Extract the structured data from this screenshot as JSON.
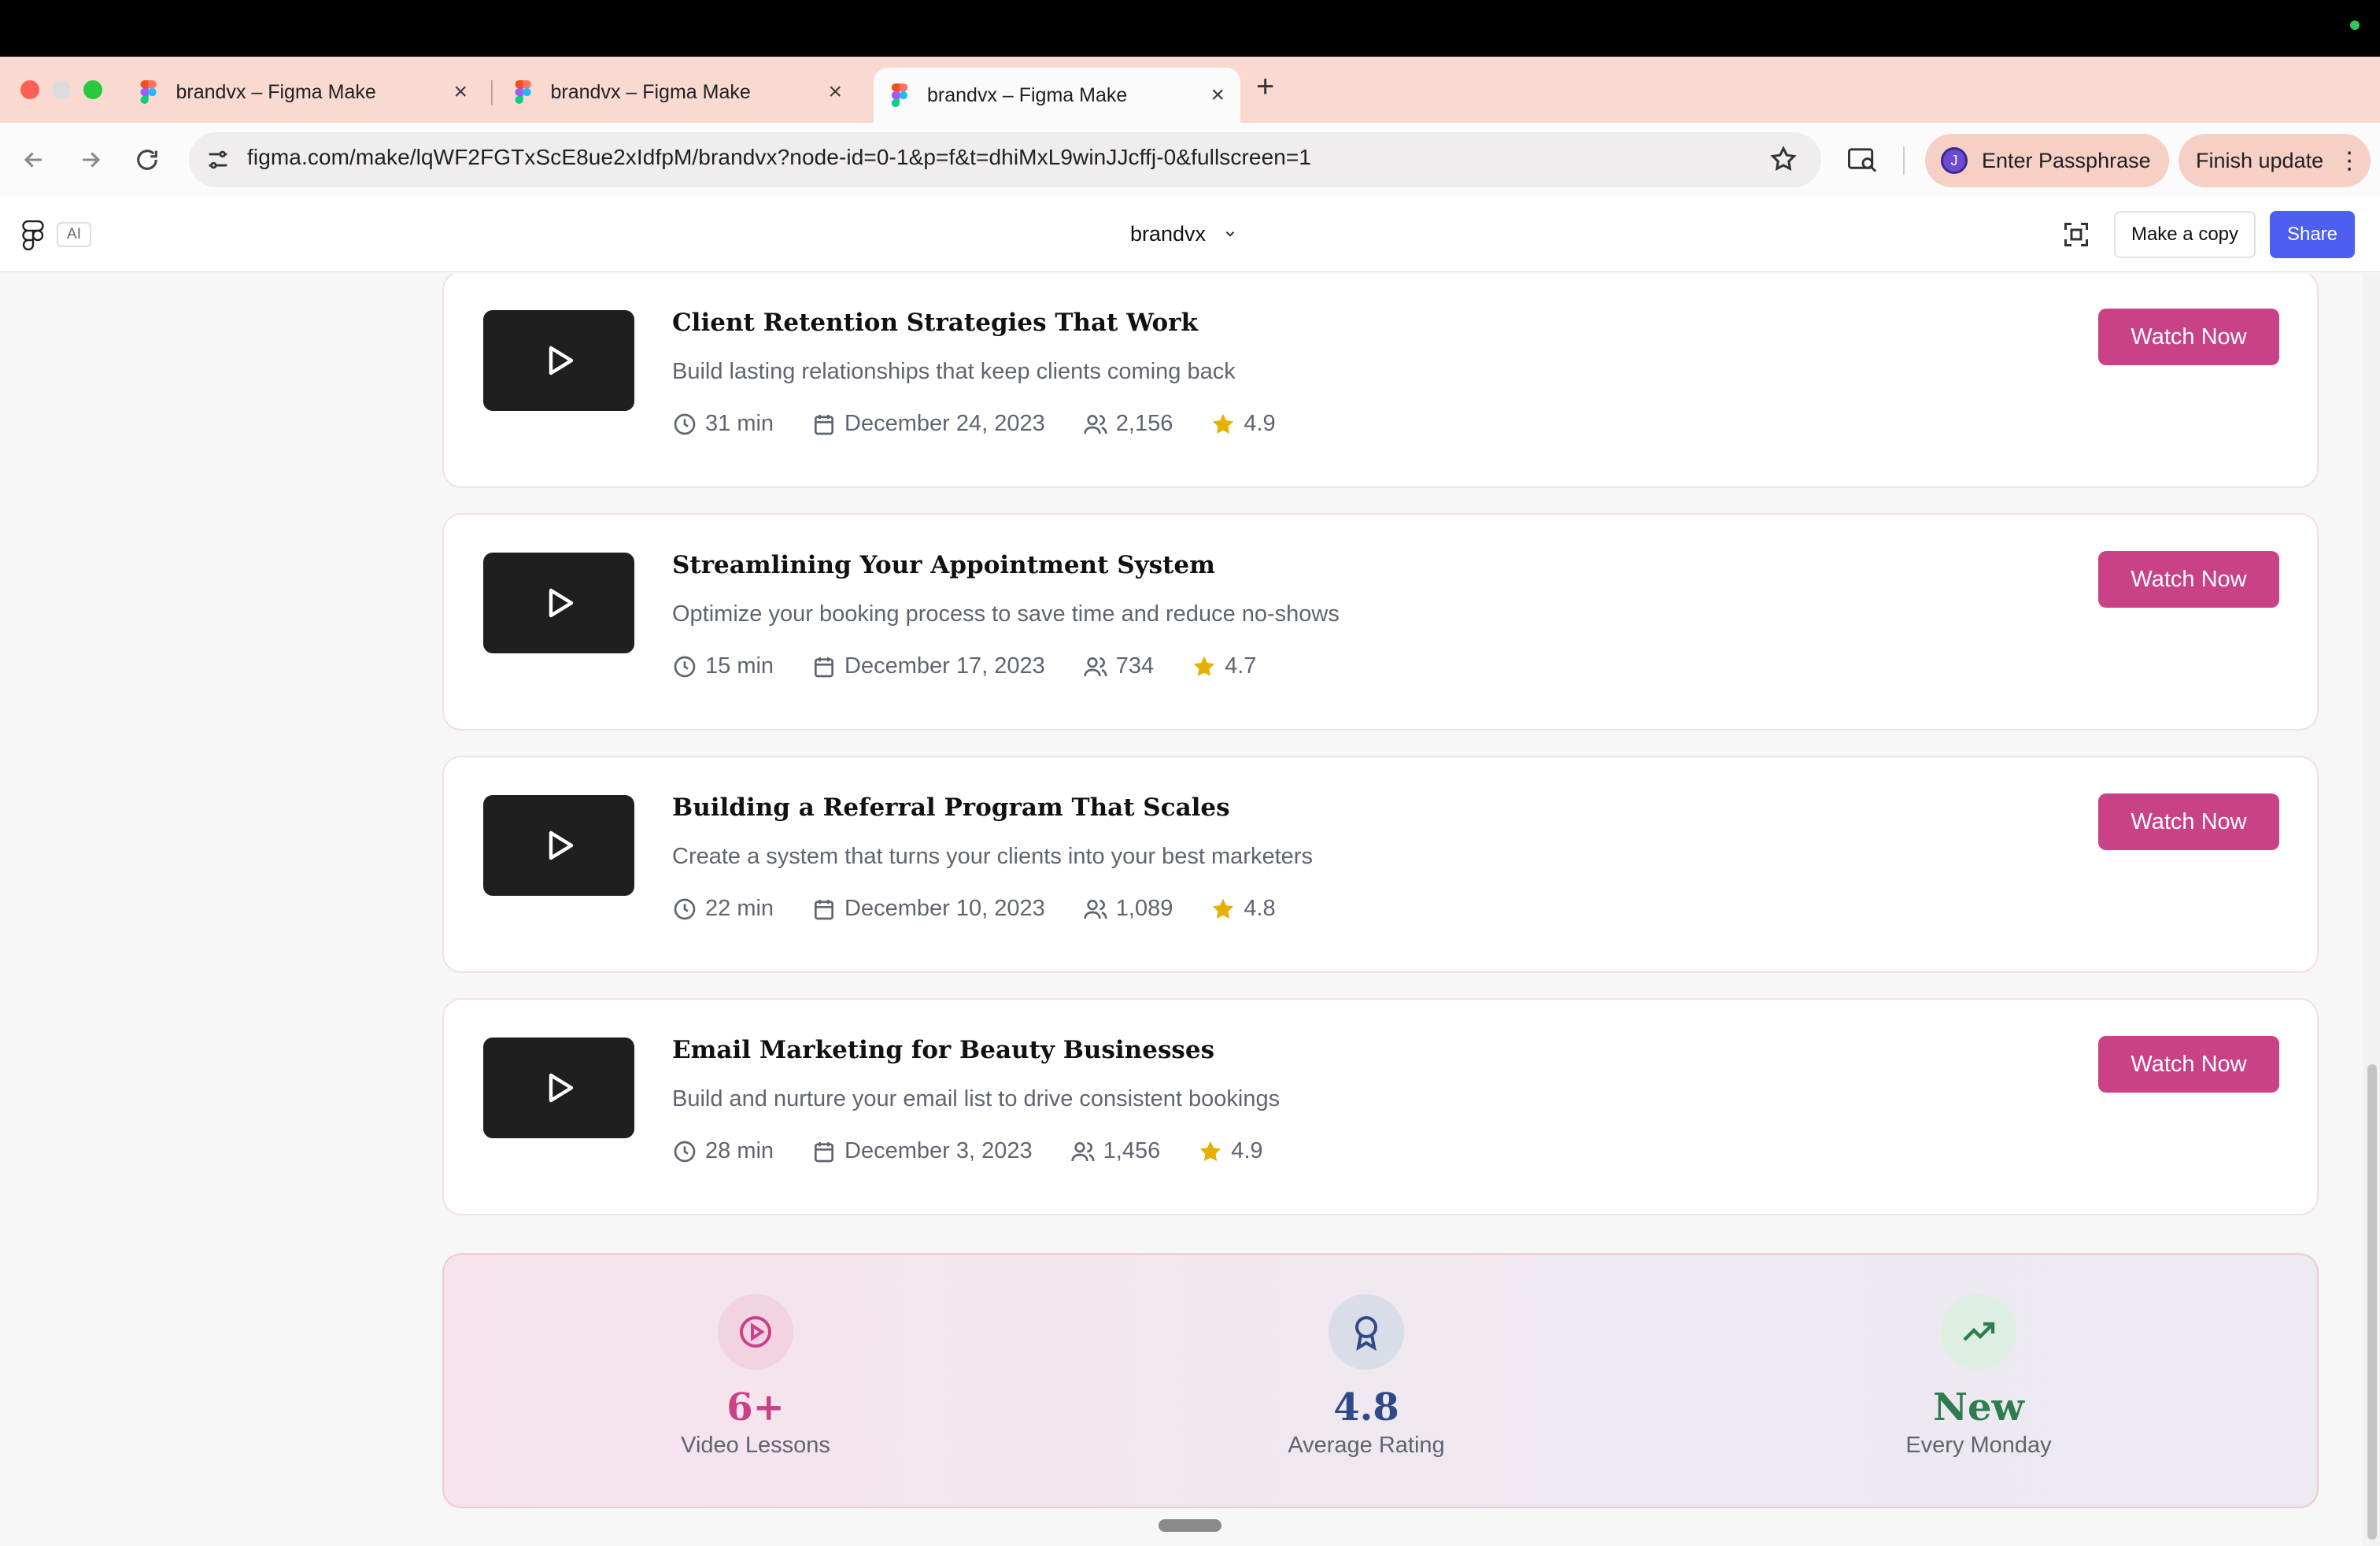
{
  "browser": {
    "tabs": [
      {
        "title": "brandvx – Figma Make"
      },
      {
        "title": "brandvx – Figma Make"
      },
      {
        "title": "brandvx – Figma Make"
      }
    ],
    "url": "figma.com/make/lqWF2FGTxScE8ue2xIdfpM/brandvx?node-id=0-1&p=f&t=dhiMxL9winJJcffj-0&fullscreen=1",
    "profile_initial": "J",
    "passphrase_label": "Enter Passphrase",
    "finish_update_label": "Finish update"
  },
  "header": {
    "ai_badge": "AI",
    "project_name": "brandvx",
    "make_copy_label": "Make a copy",
    "share_label": "Share"
  },
  "lessons": [
    {
      "title": "Client Retention Strategies That Work",
      "description": "Build lasting relationships that keep clients coming back",
      "duration": "31 min",
      "date": "December 24, 2023",
      "viewers": "2,156",
      "rating": "4.9",
      "cta": "Watch Now"
    },
    {
      "title": "Streamlining Your Appointment System",
      "description": "Optimize your booking process to save time and reduce no-shows",
      "duration": "15 min",
      "date": "December 17, 2023",
      "viewers": "734",
      "rating": "4.7",
      "cta": "Watch Now"
    },
    {
      "title": "Building a Referral Program That Scales",
      "description": "Create a system that turns your clients into your best marketers",
      "duration": "22 min",
      "date": "December 10, 2023",
      "viewers": "1,089",
      "rating": "4.8",
      "cta": "Watch Now"
    },
    {
      "title": "Email Marketing for Beauty Businesses",
      "description": "Build and nurture your email list to drive consistent bookings",
      "duration": "28 min",
      "date": "December 3, 2023",
      "viewers": "1,456",
      "rating": "4.9",
      "cta": "Watch Now"
    }
  ],
  "stats": [
    {
      "value": "6+",
      "label": "Video Lessons",
      "icon": "play-circle-icon",
      "color": "#c94187"
    },
    {
      "value": "4.8",
      "label": "Average Rating",
      "icon": "award-icon",
      "color": "#2f4a87"
    },
    {
      "value": "New",
      "label": "Every Monday",
      "icon": "trending-up-icon",
      "color": "#2e7d4f"
    }
  ],
  "colors": {
    "accent_pink": "#c94187",
    "share_blue": "#4d5ef0",
    "star_gold": "#e6b000",
    "tab_strip": "#f9d9d0"
  }
}
